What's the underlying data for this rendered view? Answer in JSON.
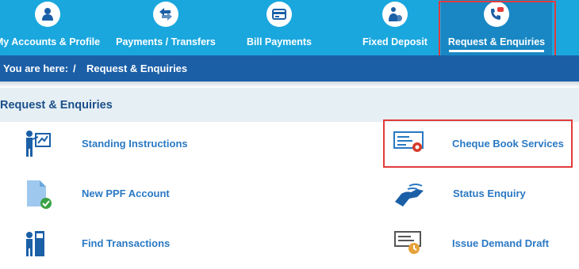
{
  "nav": {
    "tabs": [
      {
        "label": "My Accounts & Profile",
        "icon": "user-icon"
      },
      {
        "label": "Payments / Transfers",
        "icon": "transfer-arrows-icon"
      },
      {
        "label": "Bill Payments",
        "icon": "bill-card-icon"
      },
      {
        "label": "Fixed Deposit",
        "icon": "money-bag-person-icon"
      },
      {
        "label": "Request & Enquiries",
        "icon": "phone-chat-icon",
        "active": true
      }
    ]
  },
  "breadcrumb": {
    "prefix": "You are here:",
    "separator": "/",
    "current": "Request & Enquiries"
  },
  "section": {
    "title": "Request & Enquiries"
  },
  "services": {
    "left": [
      {
        "label": "Standing Instructions",
        "icon": "presenter-board-icon"
      },
      {
        "label": "New PPF Account",
        "icon": "document-check-icon"
      },
      {
        "label": "Find Transactions",
        "icon": "person-atm-icon"
      }
    ],
    "right": [
      {
        "label": "Cheque Book Services",
        "icon": "cheque-gear-icon"
      },
      {
        "label": "Status Enquiry",
        "icon": "hand-handshake-icon"
      },
      {
        "label": "Issue Demand Draft",
        "icon": "cheque-clock-icon"
      }
    ]
  },
  "colors": {
    "nav_bg": "#1aa7de",
    "nav_active_bg": "#1887c4",
    "breadcrumb_bg": "#1b5fa7",
    "section_bg": "#e6eff4",
    "link_text": "#2a79c4",
    "highlight": "#e23b3b"
  }
}
